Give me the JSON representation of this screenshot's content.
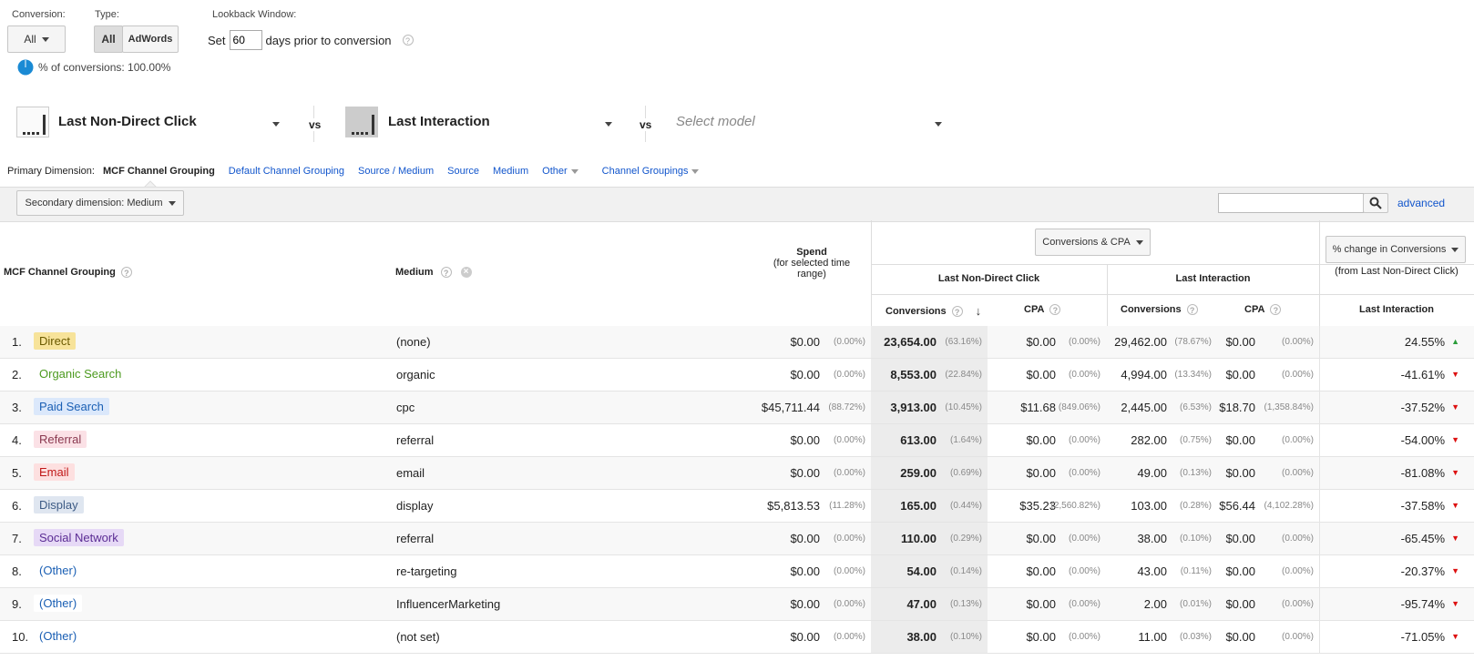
{
  "filters": {
    "conversion_label": "Conversion:",
    "conversion_value": "All",
    "type_label": "Type:",
    "type_options": [
      "All",
      "AdWords"
    ],
    "lookback_label": "Lookback Window:",
    "lookback_prefix": "Set",
    "lookback_value": "60",
    "lookback_suffix": "days prior to conversion",
    "pct_conversions": "% of conversions: 100.00%"
  },
  "models": {
    "model1": "Last Non-Direct Click",
    "vs1": "vs",
    "model2": "Last Interaction",
    "vs2": "vs",
    "model3_placeholder": "Select model"
  },
  "dimension_bar": {
    "label": "Primary Dimension:",
    "active": "MCF Channel Grouping",
    "links": [
      "Default Channel Grouping",
      "Source / Medium",
      "Source",
      "Medium",
      "Other",
      "Channel Groupings"
    ]
  },
  "toolbar": {
    "secondary_dimension": "Secondary dimension: Medium",
    "advanced_label": "advanced"
  },
  "table": {
    "col_channel": "MCF Channel Grouping",
    "col_medium": "Medium",
    "col_spend": "Spend",
    "col_spend_sub": "(for selected time range)",
    "metric_select": "Conversions & CPA",
    "change_select": "% change in Conversions",
    "change_sub": "(from Last Non-Direct Click)",
    "model1": "Last Non-Direct Click",
    "model2": "Last Interaction",
    "conversions": "Conversions",
    "cpa": "CPA",
    "change_col": "Last Interaction",
    "rows": [
      {
        "idx": "1.",
        "channel": "Direct",
        "medium": "(none)",
        "spend": "$0.00",
        "spend_pct": "(0.00%)",
        "c1": "23,654.00",
        "c1_pct": "(63.16%)",
        "cpa1": "$0.00",
        "cpa1_pct": "(0.00%)",
        "c2": "29,462.00",
        "c2_pct": "(78.67%)",
        "cpa2": "$0.00",
        "cpa2_pct": "(0.00%)",
        "change": "24.55%",
        "dir": "up"
      },
      {
        "idx": "2.",
        "channel": "Organic Search",
        "medium": "organic",
        "spend": "$0.00",
        "spend_pct": "(0.00%)",
        "c1": "8,553.00",
        "c1_pct": "(22.84%)",
        "cpa1": "$0.00",
        "cpa1_pct": "(0.00%)",
        "c2": "4,994.00",
        "c2_pct": "(13.34%)",
        "cpa2": "$0.00",
        "cpa2_pct": "(0.00%)",
        "change": "-41.61%",
        "dir": "down"
      },
      {
        "idx": "3.",
        "channel": "Paid Search",
        "medium": "cpc",
        "spend": "$45,711.44",
        "spend_pct": "(88.72%)",
        "c1": "3,913.00",
        "c1_pct": "(10.45%)",
        "cpa1": "$11.68",
        "cpa1_pct": "(849.06%)",
        "c2": "2,445.00",
        "c2_pct": "(6.53%)",
        "cpa2": "$18.70",
        "cpa2_pct": "(1,358.84%)",
        "change": "-37.52%",
        "dir": "down"
      },
      {
        "idx": "4.",
        "channel": "Referral",
        "medium": "referral",
        "spend": "$0.00",
        "spend_pct": "(0.00%)",
        "c1": "613.00",
        "c1_pct": "(1.64%)",
        "cpa1": "$0.00",
        "cpa1_pct": "(0.00%)",
        "c2": "282.00",
        "c2_pct": "(0.75%)",
        "cpa2": "$0.00",
        "cpa2_pct": "(0.00%)",
        "change": "-54.00%",
        "dir": "down"
      },
      {
        "idx": "5.",
        "channel": "Email",
        "medium": "email",
        "spend": "$0.00",
        "spend_pct": "(0.00%)",
        "c1": "259.00",
        "c1_pct": "(0.69%)",
        "cpa1": "$0.00",
        "cpa1_pct": "(0.00%)",
        "c2": "49.00",
        "c2_pct": "(0.13%)",
        "cpa2": "$0.00",
        "cpa2_pct": "(0.00%)",
        "change": "-81.08%",
        "dir": "down"
      },
      {
        "idx": "6.",
        "channel": "Display",
        "medium": "display",
        "spend": "$5,813.53",
        "spend_pct": "(11.28%)",
        "c1": "165.00",
        "c1_pct": "(0.44%)",
        "cpa1": "$35.23",
        "cpa1_pct": "(2,560.82%)",
        "c2": "103.00",
        "c2_pct": "(0.28%)",
        "cpa2": "$56.44",
        "cpa2_pct": "(4,102.28%)",
        "change": "-37.58%",
        "dir": "down"
      },
      {
        "idx": "7.",
        "channel": "Social Network",
        "medium": "referral",
        "spend": "$0.00",
        "spend_pct": "(0.00%)",
        "c1": "110.00",
        "c1_pct": "(0.29%)",
        "cpa1": "$0.00",
        "cpa1_pct": "(0.00%)",
        "c2": "38.00",
        "c2_pct": "(0.10%)",
        "cpa2": "$0.00",
        "cpa2_pct": "(0.00%)",
        "change": "-65.45%",
        "dir": "down"
      },
      {
        "idx": "8.",
        "channel": "(Other)",
        "medium": "re-targeting",
        "spend": "$0.00",
        "spend_pct": "(0.00%)",
        "c1": "54.00",
        "c1_pct": "(0.14%)",
        "cpa1": "$0.00",
        "cpa1_pct": "(0.00%)",
        "c2": "43.00",
        "c2_pct": "(0.11%)",
        "cpa2": "$0.00",
        "cpa2_pct": "(0.00%)",
        "change": "-20.37%",
        "dir": "down"
      },
      {
        "idx": "9.",
        "channel": "(Other)",
        "medium": "InfluencerMarketing",
        "spend": "$0.00",
        "spend_pct": "(0.00%)",
        "c1": "47.00",
        "c1_pct": "(0.13%)",
        "cpa1": "$0.00",
        "cpa1_pct": "(0.00%)",
        "c2": "2.00",
        "c2_pct": "(0.01%)",
        "cpa2": "$0.00",
        "cpa2_pct": "(0.00%)",
        "change": "-95.74%",
        "dir": "down"
      },
      {
        "idx": "10.",
        "channel": "(Other)",
        "medium": "(not set)",
        "spend": "$0.00",
        "spend_pct": "(0.00%)",
        "c1": "38.00",
        "c1_pct": "(0.10%)",
        "cpa1": "$0.00",
        "cpa1_pct": "(0.00%)",
        "c2": "11.00",
        "c2_pct": "(0.03%)",
        "cpa2": "$0.00",
        "cpa2_pct": "(0.00%)",
        "change": "-71.05%",
        "dir": "down"
      }
    ]
  },
  "channel_colors": {
    "Direct": {
      "bg": "#f7e39a",
      "fg": "#6b5a00"
    },
    "Organic Search": {
      "bg": "#ffffff",
      "fg": "#4c9a1f"
    },
    "Paid Search": {
      "bg": "#dbe8fb",
      "fg": "#1a5fb4"
    },
    "Referral": {
      "bg": "#fbe1e6",
      "fg": "#8a3950"
    },
    "Email": {
      "bg": "#fde0e0",
      "fg": "#c01818"
    },
    "Display": {
      "bg": "#dfe6f0",
      "fg": "#3d5b85"
    },
    "Social Network": {
      "bg": "#e6d9f6",
      "fg": "#5b2c94"
    },
    "(Other)": {
      "bg": "#ffffff",
      "fg": "#1a5fb4"
    }
  },
  "colors": {
    "link": "#1155cc",
    "up": "#2a9d3a",
    "down": "#dd1111",
    "pie": "#1a8ad4"
  }
}
